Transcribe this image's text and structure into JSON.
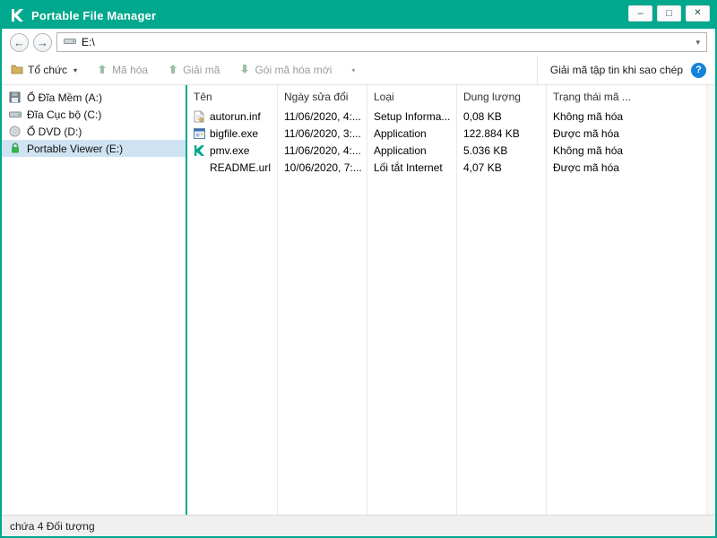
{
  "window": {
    "title": "Portable File Manager"
  },
  "icons": {
    "minimize": "–",
    "maximize": "□",
    "close": "✕",
    "back": "←",
    "forward": "→",
    "chevron_down": "▾",
    "help": "?"
  },
  "addressbar": {
    "path": "E:\\"
  },
  "toolbar": {
    "items": [
      {
        "label": "Tổ chức",
        "enabled": true
      },
      {
        "label": "Mã hóa",
        "enabled": false
      },
      {
        "label": "Giải mã",
        "enabled": false
      },
      {
        "label": "Gói mã hóa mới",
        "enabled": false
      }
    ],
    "right_label": "Giải mã tập tin khi sao chép"
  },
  "sidebar": {
    "items": [
      {
        "label": "Ổ Đĩa Mềm (A:)",
        "icon": "floppy-drive-icon",
        "selected": false
      },
      {
        "label": "Đĩa Cục bộ (C:)",
        "icon": "hard-drive-icon",
        "selected": false
      },
      {
        "label": "Ổ DVD (D:)",
        "icon": "dvd-drive-icon",
        "selected": false
      },
      {
        "label": "Portable Viewer (E:)",
        "icon": "encrypted-lock-icon",
        "selected": true
      }
    ]
  },
  "filelist": {
    "columns": [
      "Tên",
      "Ngày sửa đổi",
      "Loại",
      "Dung lượng",
      "Trạng thái mã ..."
    ],
    "rows": [
      {
        "name": "autorun.inf",
        "modified": "11/06/2020, 4:...",
        "type": "Setup Informa...",
        "size": "0,08 KB",
        "status": "Không mã hóa",
        "icon": "inf-file-icon"
      },
      {
        "name": "bigfile.exe",
        "modified": "11/06/2020, 3:...",
        "type": "Application",
        "size": "122.884 KB",
        "status": "Được mã hóa",
        "icon": "exe-file-icon"
      },
      {
        "name": "pmv.exe",
        "modified": "11/06/2020, 4:...",
        "type": "Application",
        "size": "5.036 KB",
        "status": "Không mã hóa",
        "icon": "kaspersky-k-icon"
      },
      {
        "name": "README.url",
        "modified": "10/06/2020, 7:...",
        "type": "Lối tắt Internet",
        "size": "4,07 KB",
        "status": "Được mã hóa",
        "icon": "url-file-icon"
      }
    ]
  },
  "statusbar": {
    "text": "chứa 4 Đối tượng"
  },
  "colors": {
    "titlebar_teal": "#00a88e",
    "divider_teal": "#00a88e",
    "selection_blue": "#cfe3f2",
    "help_blue": "#1283d8",
    "lock_green": "#37b24d",
    "kaspersky_green": "#00a88e"
  }
}
